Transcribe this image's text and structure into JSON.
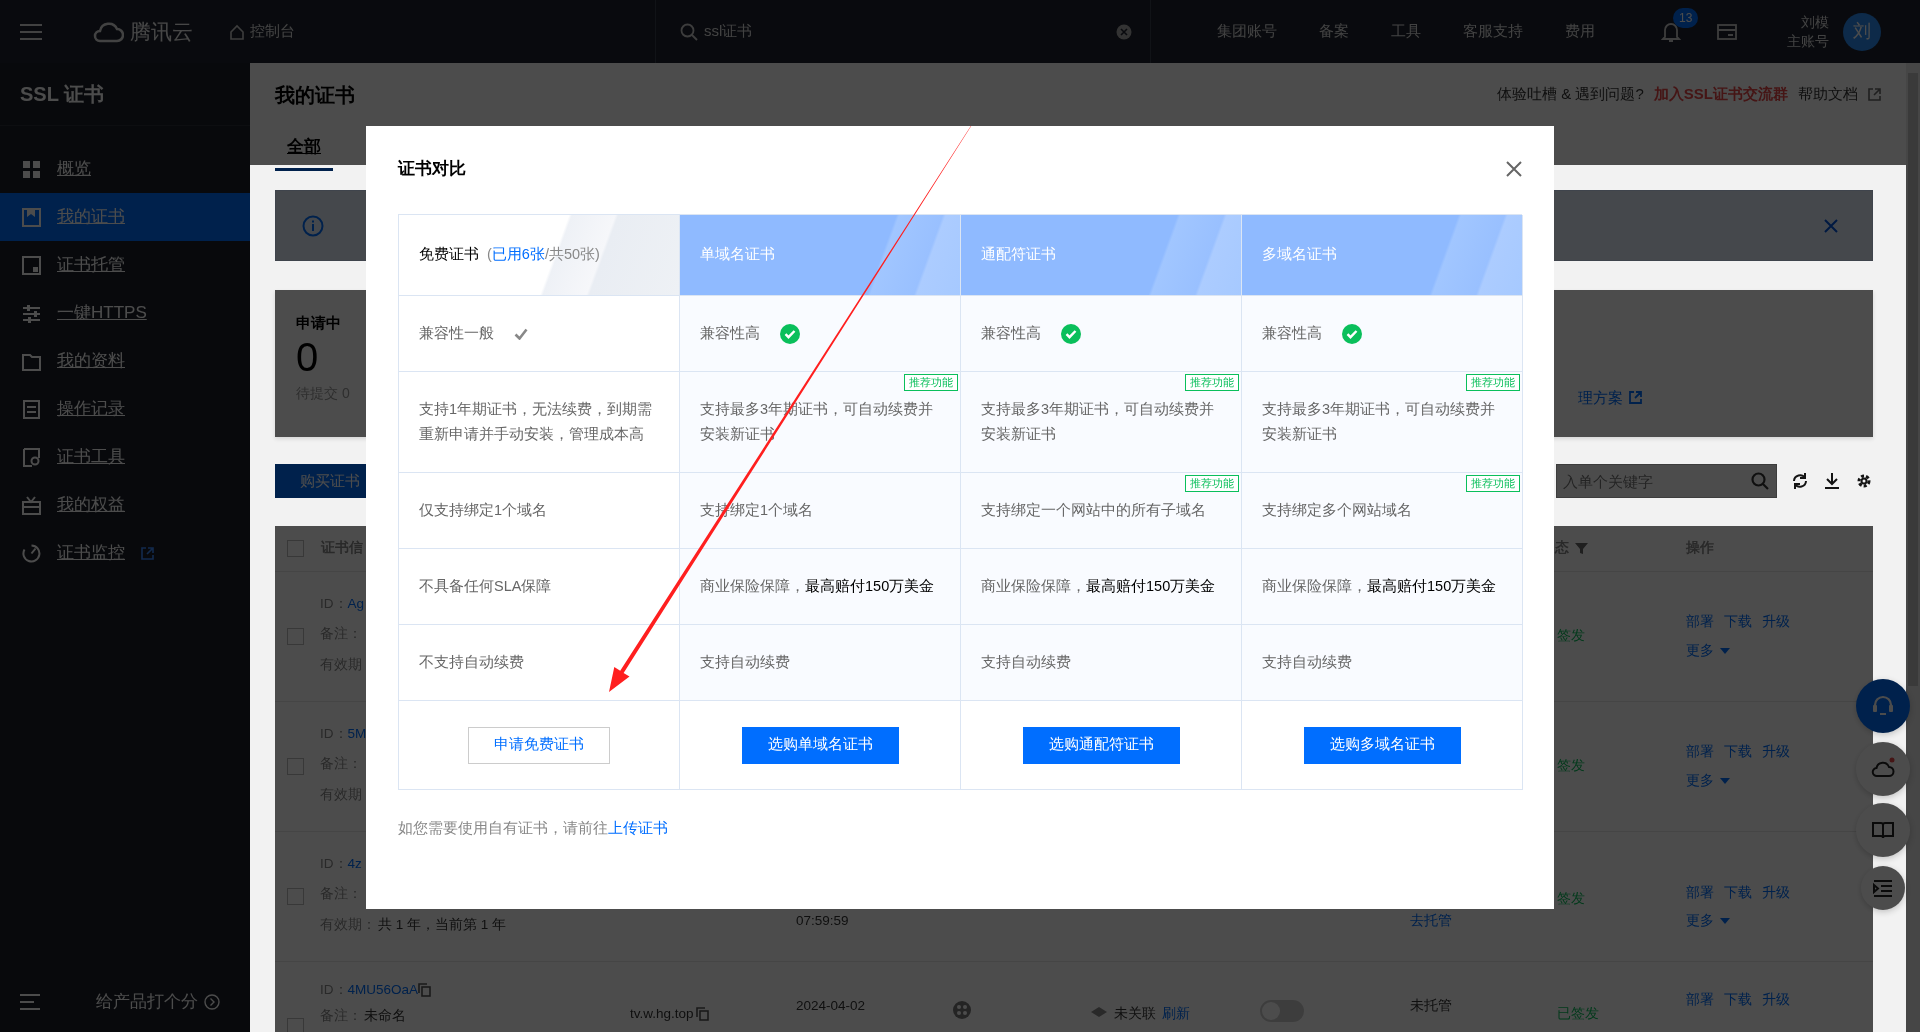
{
  "topbar": {
    "brand": "腾讯云",
    "console": "控制台",
    "search": {
      "value": "ssl证书"
    },
    "nav": [
      "集团账号",
      "备案",
      "工具",
      "客服支持",
      "费用"
    ],
    "notifications": "13",
    "account": {
      "name": "刘模",
      "role": "主账号",
      "avatar": "刘"
    }
  },
  "sidebar": {
    "title": "SSL 证书",
    "items": [
      {
        "label": "概览",
        "selected": false,
        "external": false
      },
      {
        "label": "我的证书",
        "selected": true,
        "external": false
      },
      {
        "label": "证书托管",
        "selected": false,
        "external": false
      },
      {
        "label": "一键HTTPS",
        "selected": false,
        "external": false
      },
      {
        "label": "我的资料",
        "selected": false,
        "external": false
      },
      {
        "label": "操作记录",
        "selected": false,
        "external": false
      },
      {
        "label": "证书工具",
        "selected": false,
        "external": false
      },
      {
        "label": "我的权益",
        "selected": false,
        "external": false
      },
      {
        "label": "证书监控",
        "selected": false,
        "external": true
      }
    ],
    "feedback": "给产品打个分"
  },
  "page": {
    "title": "我的证书",
    "help": {
      "question": "体验吐槽 & 遇到问题?",
      "group_link": "加入SSL证书交流群",
      "docs": "帮助文档"
    },
    "tabs": [
      {
        "label": "全部",
        "selected": true
      }
    ],
    "stat": {
      "label": "申请中",
      "value": "0",
      "sub": "待提交 0",
      "link": "理方案"
    },
    "buy_button": "购买证书",
    "search": {
      "placeholder": "入单个关键字"
    },
    "table": {
      "select_all": {
        "checked": false
      },
      "columns": {
        "info": "证书信",
        "status": "态",
        "actions": "操作"
      },
      "rows": [
        {
          "checked": false,
          "id_label": "ID：",
          "id": "Ag",
          "remark_label": "备注：",
          "validity_label": "有效期",
          "status": "签发",
          "actions": [
            "部署",
            "下载",
            "升级"
          ],
          "more": "更多"
        },
        {
          "checked": false,
          "id_label": "ID：",
          "id": "5M",
          "remark_label": "备注：",
          "validity_label": "有效期",
          "status": "签发",
          "actions": [
            "部署",
            "下载",
            "升级"
          ],
          "more": "更多"
        },
        {
          "checked": false,
          "id_label": "ID：",
          "id": "4z",
          "remark_label": "备注：",
          "validity_label": "有效期：",
          "validity": "共 1 年，当前第 1 年",
          "time": "07:59:59",
          "hosting": {
            "text": "去托管",
            "link": true
          },
          "status": "签发",
          "actions": [
            "部署",
            "下载",
            "升级"
          ],
          "more": "更多"
        },
        {
          "checked": false,
          "id_label": "ID：",
          "id": "4MU56OaA",
          "remark_label": "备注：",
          "remark": "未命名",
          "domain": "tv.w.hg.top",
          "time": "2024-04-02",
          "relation": "未关联",
          "refresh": "刷新",
          "toggle": {
            "on": false
          },
          "hosting": {
            "text": "未托管",
            "link": false
          },
          "status": "已签发",
          "actions": [
            "部署",
            "下载",
            "升级"
          ]
        }
      ]
    }
  },
  "modal": {
    "title": "证书对比",
    "columns": [
      {
        "name": "免费证书",
        "kind": "free",
        "quota": {
          "open": "(",
          "used": "已用6张",
          "rest": "/共50张)"
        },
        "cells": [
          {
            "kind": "basic",
            "text": "兼容性一般"
          },
          {
            "kind": "text",
            "text": "支持1年期证书，无法续费，到期需重新申请并手动安装，管理成本高"
          },
          {
            "kind": "text",
            "text": "仅支持绑定1个域名"
          },
          {
            "kind": "text",
            "text": "不具备任何SLA保障"
          },
          {
            "kind": "text",
            "text": "不支持自动续费"
          }
        ],
        "button": {
          "label": "申请免费证书",
          "kind": "outline"
        }
      },
      {
        "name": "单域名证书",
        "kind": "paid",
        "cells": [
          {
            "kind": "high",
            "text": "兼容性高"
          },
          {
            "kind": "text",
            "text": "支持最多3年期证书，可自动续费并安装新证书",
            "badge": "推荐功能"
          },
          {
            "kind": "text",
            "text": "支持绑定1个域名"
          },
          {
            "kind": "text",
            "text": "商业保险保障，**最高赔付150万美金**"
          },
          {
            "kind": "text",
            "text": "支持自动续费"
          }
        ],
        "button": {
          "label": "选购单域名证书",
          "kind": "primary"
        }
      },
      {
        "name": "通配符证书",
        "kind": "paid",
        "cells": [
          {
            "kind": "high",
            "text": "兼容性高"
          },
          {
            "kind": "text",
            "text": "支持最多3年期证书，可自动续费并安装新证书",
            "badge": "推荐功能"
          },
          {
            "kind": "text",
            "text": "支持绑定一个网站中的所有子域名",
            "badge": "推荐功能"
          },
          {
            "kind": "text",
            "text": "商业保险保障，**最高赔付150万美金**"
          },
          {
            "kind": "text",
            "text": "支持自动续费"
          }
        ],
        "button": {
          "label": "选购通配符证书",
          "kind": "primary"
        }
      },
      {
        "name": "多域名证书",
        "kind": "paid",
        "cells": [
          {
            "kind": "high",
            "text": "兼容性高"
          },
          {
            "kind": "text",
            "text": "支持最多3年期证书，可自动续费并安装新证书",
            "badge": "推荐功能"
          },
          {
            "kind": "text",
            "text": "支持绑定多个网站域名",
            "badge": "推荐功能"
          },
          {
            "kind": "text",
            "text": "商业保险保障，**最高赔付150万美金**"
          },
          {
            "kind": "text",
            "text": "支持自动续费"
          }
        ],
        "button": {
          "label": "选购多域名证书",
          "kind": "primary"
        }
      }
    ],
    "footer": {
      "text": "如您需要使用自有证书，请前往",
      "link": "上传证书"
    }
  }
}
